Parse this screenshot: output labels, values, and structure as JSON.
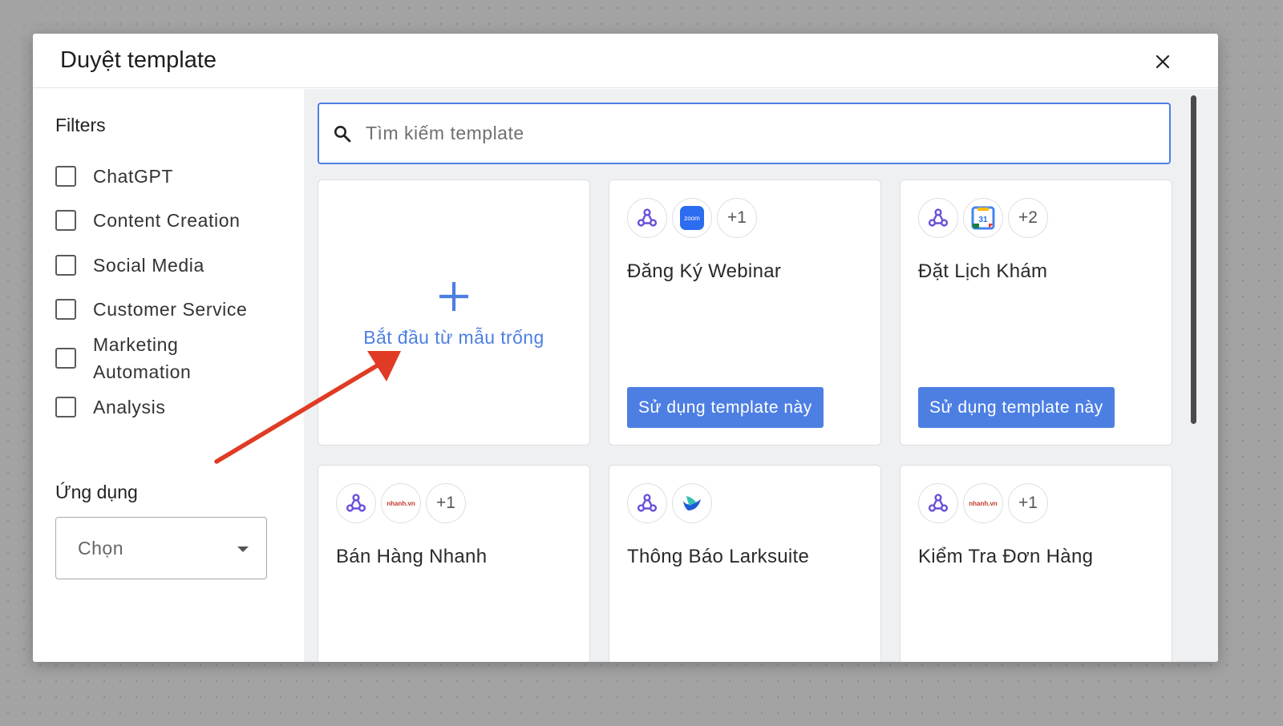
{
  "modal": {
    "title": "Duyệt template"
  },
  "sidebar": {
    "filters_title": "Filters",
    "filters": [
      {
        "label": "ChatGPT",
        "checked": false
      },
      {
        "label": "Content Creation",
        "checked": false
      },
      {
        "label": "Social Media",
        "checked": false
      },
      {
        "label": "Customer Service",
        "checked": false
      },
      {
        "label": "Marketing Automation",
        "checked": false
      },
      {
        "label": "Analysis",
        "checked": false
      }
    ],
    "apps_title": "Ứng dụng",
    "apps_select_value": "Chọn"
  },
  "search": {
    "placeholder": "Tìm kiếm template"
  },
  "blank_template": {
    "label": "Bắt đầu từ mẫu trống"
  },
  "templates": [
    {
      "title": "Đăng Ký Webinar",
      "apps": [
        "webhook-icon",
        "zoom-icon"
      ],
      "more": "+1",
      "button": "Sử dụng template này"
    },
    {
      "title": "Đặt Lịch Khám",
      "apps": [
        "webhook-icon",
        "google-calendar-icon"
      ],
      "more": "+2",
      "button": "Sử dụng template này"
    },
    {
      "title": "Bán Hàng Nhanh",
      "apps": [
        "webhook-icon",
        "nhanh-icon"
      ],
      "more": "+1"
    },
    {
      "title": "Thông Báo Larksuite",
      "apps": [
        "webhook-icon",
        "larksuite-icon"
      ]
    },
    {
      "title": "Kiểm Tra Đơn Hàng",
      "apps": [
        "webhook-icon",
        "nhanh-icon"
      ],
      "more": "+1"
    }
  ],
  "app_labels": {
    "zoom": "zoom",
    "calendar": "31",
    "nhanh": "nhanh.vn"
  },
  "colors": {
    "accent": "#4d7fe3",
    "annotation_arrow": "#e03b24",
    "webhook": "#6b4fd8"
  }
}
